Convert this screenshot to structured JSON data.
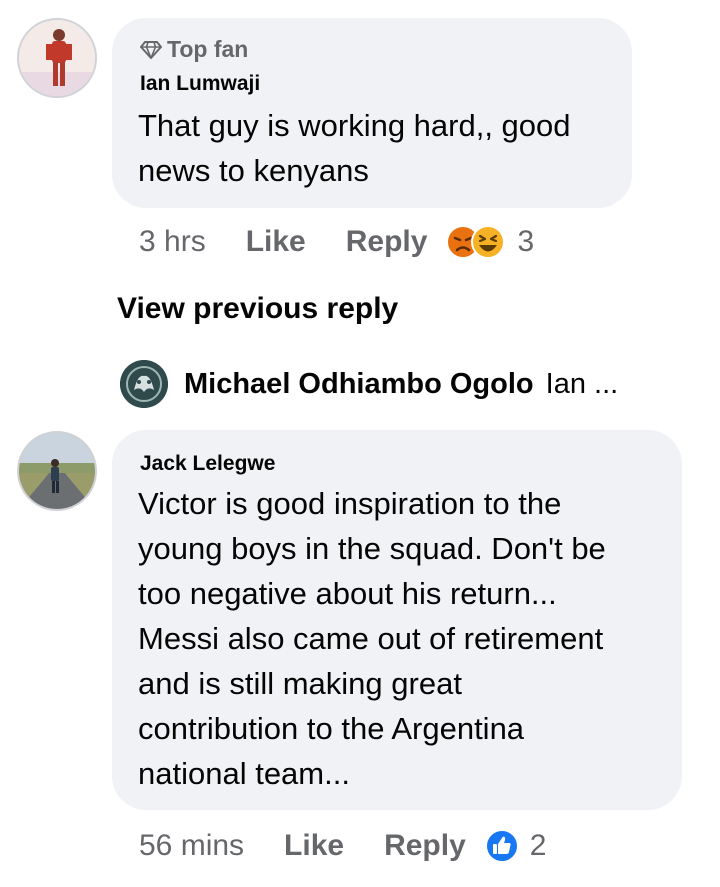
{
  "comments": [
    {
      "badge": "Top fan",
      "author": "Ian Lumwaji",
      "text": "That guy is working hard,, good\nnews to kenyans",
      "time": "3 hrs",
      "like_label": "Like",
      "reply_label": "Reply",
      "reactions": [
        "angry",
        "haha"
      ],
      "reaction_count": "3"
    },
    {
      "author": "Jack Lelegwe",
      "text": "Victor is good inspiration to the\nyoung boys in the squad. Don't be\ntoo negative about his return...\nMessi also came out of retirement\nand is still making great\ncontribution to the Argentina\nnational team...",
      "time": "56 mins",
      "like_label": "Like",
      "reply_label": "Reply",
      "reactions": [
        "like"
      ],
      "reaction_count": "2"
    }
  ],
  "view_previous": "View previous reply",
  "reply_preview": {
    "name": "Michael Odhiambo Ogolo",
    "snippet": "Ian ..."
  },
  "colors": {
    "bubble": "#f0f2f5",
    "secondary_text": "#65676b",
    "like_blue": "#1877f2",
    "angry": "#e9710f",
    "haha": "#f7b125"
  }
}
